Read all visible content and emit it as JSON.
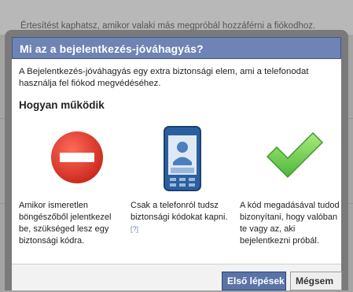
{
  "backdrop": {
    "text": "Értesítést kaphatsz, amikor valaki más megpróbál hozzáférni a fiókodhoz."
  },
  "dialog": {
    "title": "Mi az a bejelentkezés-jóváhagyás?",
    "intro": "A Bejelentkezés-jóváhagyás egy extra biztonsági elem, ami a telefonodat használja fel fiókod megvédéséhez.",
    "section_title": "Hogyan működik",
    "steps": [
      {
        "icon": "stop-icon",
        "text": "Amikor ismeretlen böngészőből jelentkezel be, szükséged lesz egy biztonsági kódra."
      },
      {
        "icon": "phone-icon",
        "text": "Csak a telefonról tudsz biztonsági kódokat kapni.",
        "help": "[?]"
      },
      {
        "icon": "checkmark-icon",
        "text": "A kód megadásával tudod bizonyítani, hogy valóban te vagy az, aki bejelentkezni próbál."
      }
    ],
    "buttons": {
      "primary": "Első lépések",
      "secondary": "Mégsem"
    }
  },
  "colors": {
    "header_bg": "#6d84b4",
    "primary_button": "#5b74a8",
    "stop_red": "#e03b2c",
    "check_green": "#7ed957"
  }
}
